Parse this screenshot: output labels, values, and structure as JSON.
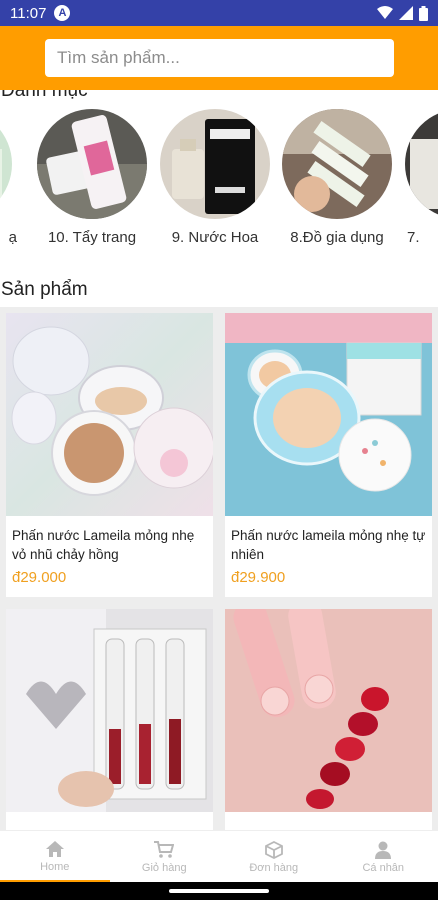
{
  "status_bar": {
    "time": "11:07",
    "app_badge": "A"
  },
  "search": {
    "placeholder": "Tìm sản phẩm..."
  },
  "categories": {
    "heading": "Danh mục",
    "items": [
      {
        "label": "ạ"
      },
      {
        "label": "10. Tẩy trang"
      },
      {
        "label": "9. Nước Hoa"
      },
      {
        "label": "8.Đồ gia dụng"
      },
      {
        "label": "7."
      }
    ]
  },
  "products": {
    "heading": "Sản phẩm",
    "items": [
      {
        "name": "Phấn nước Lameila mỏng nhẹ vỏ nhũ chảy hồng",
        "price": "đ29.000"
      },
      {
        "name": "Phấn nước lameila mỏng nhẹ tự nhiên",
        "price": "đ29.900"
      },
      {
        "name": "",
        "price": ""
      },
      {
        "name": "",
        "price": ""
      }
    ]
  },
  "bottom_nav": [
    {
      "label": "Home",
      "icon": "home-icon"
    },
    {
      "label": "Giỏ hàng",
      "icon": "cart-icon"
    },
    {
      "label": "Đơn hàng",
      "icon": "box-icon"
    },
    {
      "label": "Cá nhân",
      "icon": "user-icon"
    }
  ],
  "colors": {
    "accent": "#ff9d00",
    "status_bar": "#3441a8",
    "price": "#f0a020"
  }
}
